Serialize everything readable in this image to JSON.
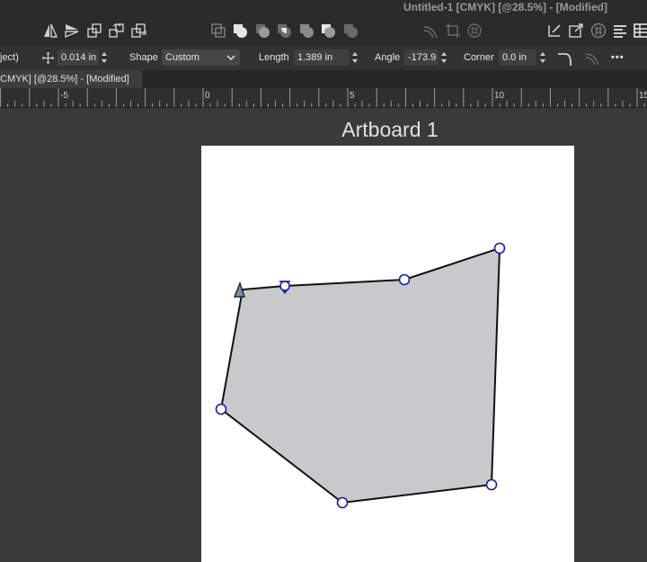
{
  "window": {
    "title": "Untitled-1 [CMYK] [@28.5%] - [Modified]"
  },
  "context_bar": {
    "selection_label": "ject)",
    "position_value": "0.014 in",
    "shape_label": "Shape",
    "shape_value": "Custom",
    "length_label": "Length",
    "length_value": "1.389 in",
    "angle_label": "Angle",
    "angle_value": "-173.9",
    "corner_label": "Corner",
    "corner_value": "0.0 in",
    "more_label": "•••"
  },
  "document_tab": {
    "label": "CMYK] [@28.5%] - [Modified]"
  },
  "ruler": {
    "labels": [
      "-5",
      "0",
      "5",
      "10",
      "15"
    ]
  },
  "artboard": {
    "label": "Artboard 1",
    "background": "#ffffff"
  },
  "shape": {
    "fill": "#c8c9ca",
    "stroke": "#111111",
    "node_color": "#1a1aa8"
  }
}
